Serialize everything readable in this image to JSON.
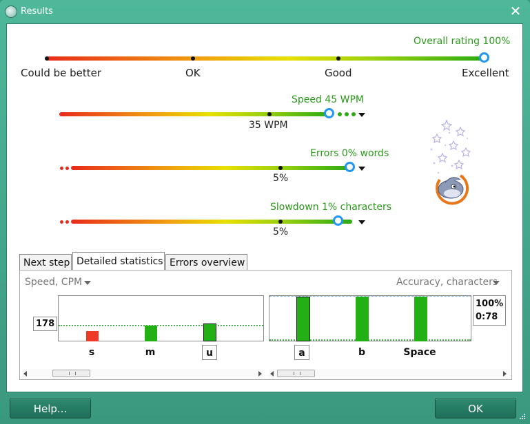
{
  "window": {
    "title": "Results",
    "close_glyph": "✕",
    "app_icon": "dolphin-icon"
  },
  "overall": {
    "label": "Overall rating 100%",
    "marks": [
      "Could be better",
      "OK",
      "Good",
      "Excellent"
    ],
    "value_percent": 100
  },
  "speed": {
    "label": "Speed 45 WPM",
    "reference": "35 WPM",
    "value_wpm": 45
  },
  "errors": {
    "label": "Errors 0% words",
    "reference": "5%",
    "value_percent": 0
  },
  "slowdown": {
    "label": "Slowdown 1% characters",
    "reference": "5%",
    "value_percent": 1
  },
  "tabs": [
    {
      "label": "Next step",
      "active": false
    },
    {
      "label": "Detailed statistics",
      "active": true
    },
    {
      "label": "Errors overview",
      "active": false
    }
  ],
  "left_chart": {
    "dropdown_label": "Speed, CPM",
    "average_value": "178",
    "keys": [
      "s",
      "m",
      "u"
    ],
    "selected_key": "u"
  },
  "right_chart": {
    "dropdown_label": "Accuracy, characters",
    "value_line1": "100%",
    "value_line2": "0:78",
    "keys": [
      "a",
      "b",
      "Space"
    ],
    "selected_key": "a"
  },
  "footer": {
    "help_label": "Help...",
    "ok_label": "OK"
  },
  "colors": {
    "accent_green": "#2a9a1a",
    "knob_blue": "#2196f3",
    "window_teal": "#3a9a80"
  }
}
